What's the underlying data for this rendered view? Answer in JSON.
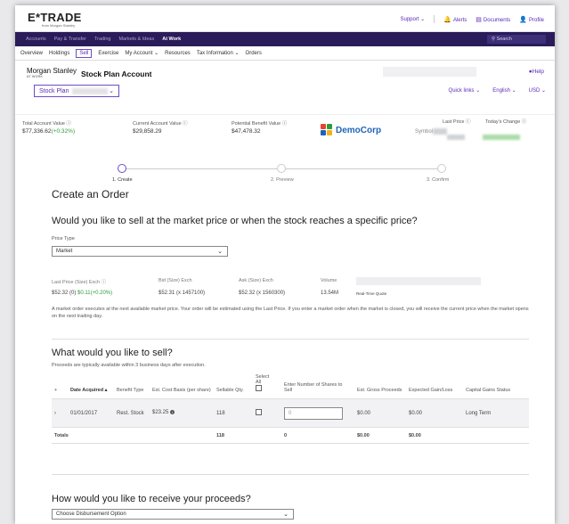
{
  "header": {
    "logo": "E*TRADE",
    "logo_sub": "from Morgan Stanley",
    "support": "Support ⌄",
    "alerts": "Alerts",
    "documents": "Documents",
    "profile": "Profile"
  },
  "nav": {
    "items": [
      "Accounts",
      "Pay & Transfer",
      "Trading",
      "Markets & Ideas",
      "At Work"
    ],
    "active_index": 4,
    "search_placeholder": "Search"
  },
  "subnav": {
    "items": [
      "Overview",
      "Holdings",
      "Sell",
      "Exercise",
      "My Account ⌄",
      "Resources",
      "Tax Information ⌄",
      "Orders"
    ],
    "selected_index": 2
  },
  "account": {
    "brand": "Morgan Stanley",
    "brand_sub": "AT WORK",
    "title": "Stock Plan Account",
    "help": "Help",
    "plan_label": "Stock Plan",
    "quick_links": "Quick links ⌄",
    "language": "English ⌄",
    "currency": "USD ⌄"
  },
  "stats": {
    "total_label": "Total Account Value ⓘ",
    "total_value": "$77,336.62",
    "total_change": "(+0.32%)",
    "current_label": "Current Account Value ⓘ",
    "current_value": "$29,858.29",
    "benefit_label": "Potential Benefit Value ⓘ",
    "benefit_value": "$47,478.32",
    "company": "DemoCorp",
    "symbol_label": "Symbol",
    "last_price_label": "Last Price ⓘ",
    "todays_change_label": "Today's Change ⓘ"
  },
  "steps": [
    "1. Create",
    "2. Preview",
    "3. Confirm"
  ],
  "order": {
    "heading": "Create an Order",
    "question": "Would you like to sell at the market price or when the stock reaches a specific price?",
    "price_type_label": "Price Type",
    "price_type_value": "Market",
    "last_price_label": "Last Price (Size) Exch ⓘ",
    "last_price_value": "$52.32 (0)",
    "last_price_change": "$0.11(+0.20%)",
    "bid_label": "Bid (Size) Exch",
    "bid_value": "$52.31 (x 1457100)",
    "ask_label": "Ask (Size) Exch",
    "ask_value": "$52.32 (x 1560300)",
    "volume_label": "Volume",
    "volume_value": "13.54M",
    "realtime": "Real-Time Quote",
    "note": "A market order executes at the next available market price. Your order will be estimated using the Last Price. If you enter a market order when the market is closed, you will receive the current price when the market opens on the next trading day."
  },
  "sell": {
    "question": "What would you like to sell?",
    "subtitle": "Proceeds are typically available within 3 business days after execution.",
    "headers": [
      "Date Acquired",
      "Benefit Type",
      "Est. Cost Basis (per share)",
      "Sellable Qty.",
      "Select All",
      "Enter Number of Shares to Sell",
      "Est. Gross Proceeds",
      "Expected Gain/Loss",
      "Capital Gains Status"
    ],
    "row": {
      "date": "01/01/2017",
      "benefit": "Rest. Stock",
      "cost": "$23.25",
      "qty": "118",
      "shares_placeholder": "0",
      "proceeds": "$0.00",
      "gain": "$0.00",
      "status": "Long Term"
    },
    "totals": {
      "label": "Totals",
      "qty": "118",
      "shares": "0",
      "proceeds": "$0.00",
      "gain": "$0.00"
    }
  },
  "proceeds": {
    "question": "How would you like to receive your proceeds?",
    "dropdown": "Choose Disbursement Option"
  }
}
